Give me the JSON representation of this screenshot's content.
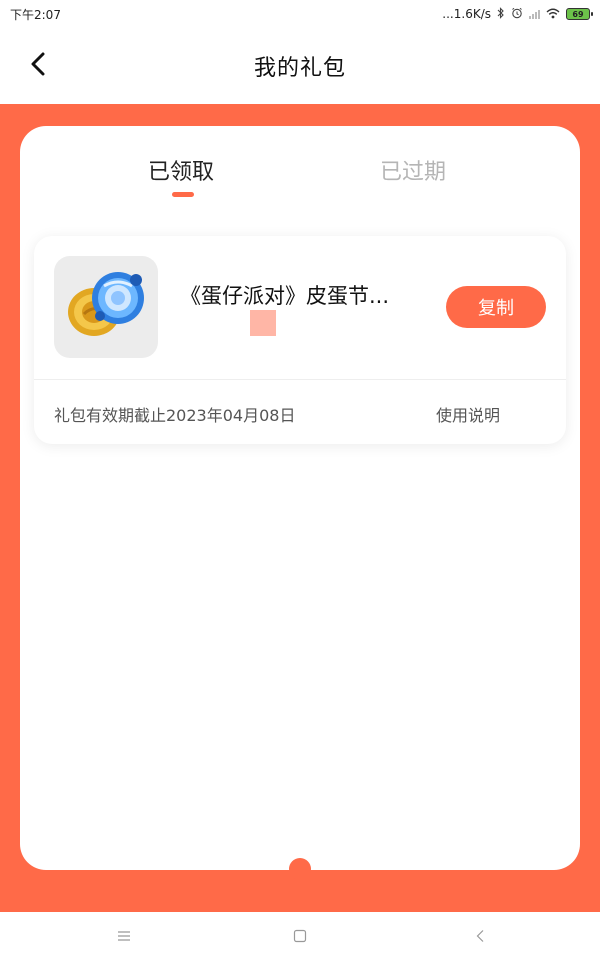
{
  "status_bar": {
    "time": "下午2:07",
    "network_speed": "...1.6K/s",
    "bluetooth_icon": "bluetooth-icon",
    "alarm_icon": "alarm-icon",
    "signal_icon": "signal-icon",
    "wifi_icon": "wifi-icon",
    "battery_level": "69"
  },
  "header": {
    "back_icon": "chevron-left-icon",
    "title": "我的礼包"
  },
  "tabs": [
    {
      "label": "已领取",
      "active": true
    },
    {
      "label": "已过期",
      "active": false
    }
  ],
  "gift_card": {
    "game_icon": "game-icon",
    "title": "《蛋仔派对》皮蛋节...",
    "copy_label": "复制",
    "validity": "礼包有效期截止2023年04月08日",
    "usage_label": "使用说明"
  },
  "nav_bar": {
    "menu_icon": "menu-icon",
    "home_icon": "home-square-icon",
    "back_icon": "back-triangle-icon"
  },
  "colors": {
    "accent": "#ff6a48",
    "inactive_tab": "#b5b5b5",
    "copy_text": "#ffffff"
  }
}
